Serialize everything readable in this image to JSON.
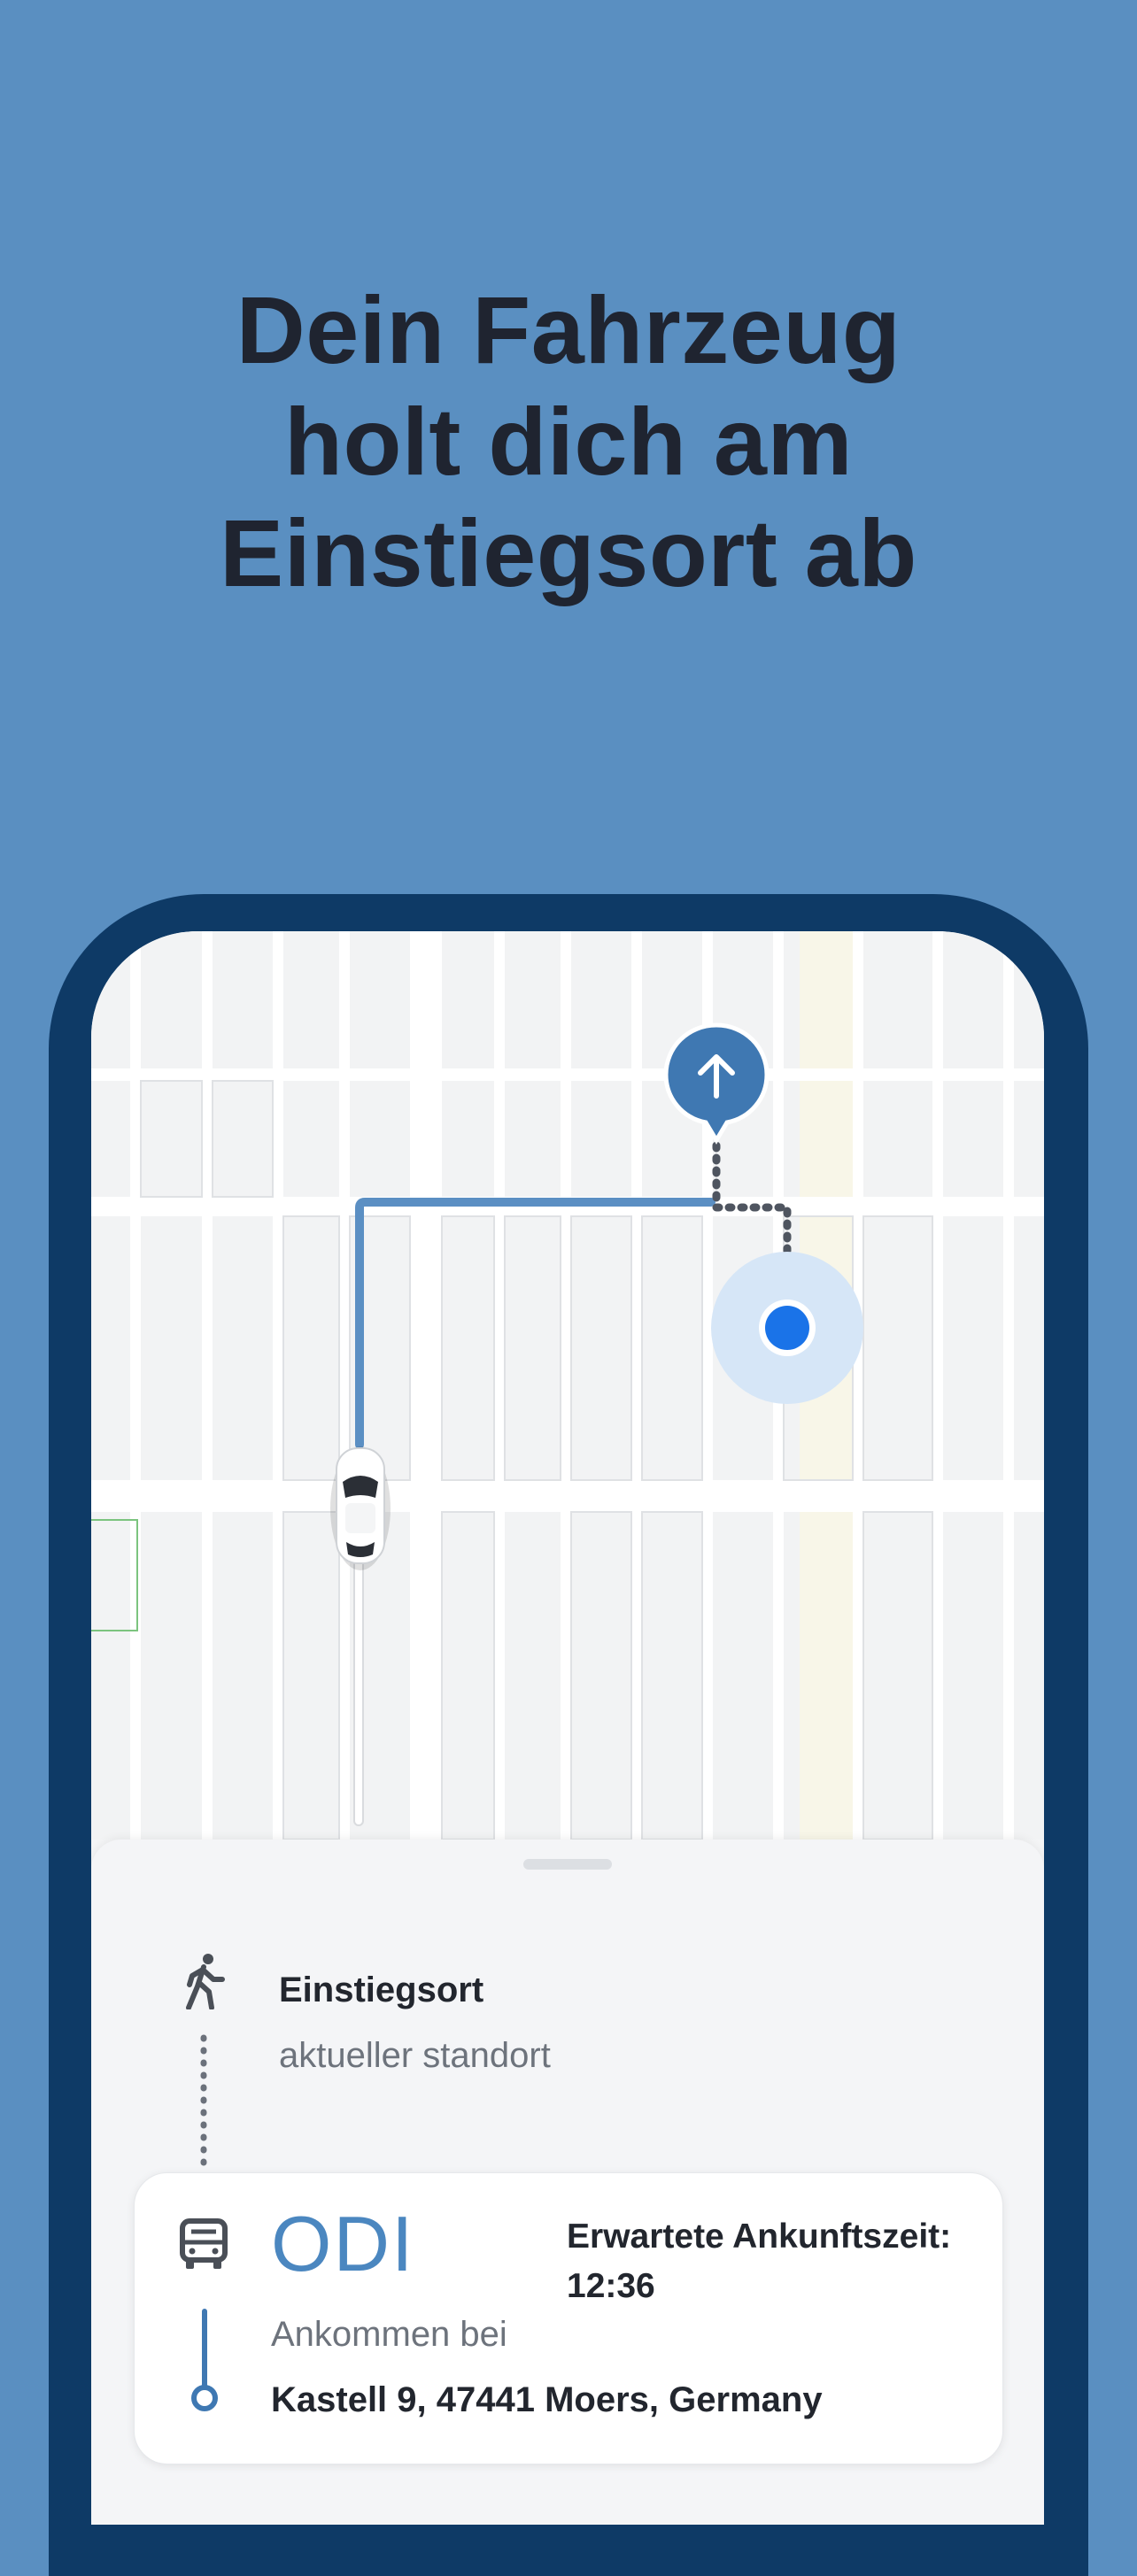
{
  "headline": {
    "line1": "Dein Fahrzeug",
    "line2": "holt dich am",
    "line3": "Einstiegsort ab"
  },
  "colors": {
    "background": "#5a8fc1",
    "phone_frame": "#0e3a66",
    "accent": "#4b87c0",
    "user_dot": "#1a73e8"
  },
  "map": {
    "icons": [
      "navigation-arrow-icon",
      "car-icon",
      "user-location-icon"
    ]
  },
  "sheet": {
    "pickup": {
      "icon": "walking-person-icon",
      "title": "Einstiegsort",
      "subtitle": "aktueller standort"
    },
    "vehicle_card": {
      "icon": "bus-icon",
      "name": "ODI",
      "eta": "Erwartete Ankunftszeit: 12:36",
      "arrive_label": "Ankommen bei",
      "arrive_address": "Kastell 9, 47441 Moers, Germany"
    }
  }
}
